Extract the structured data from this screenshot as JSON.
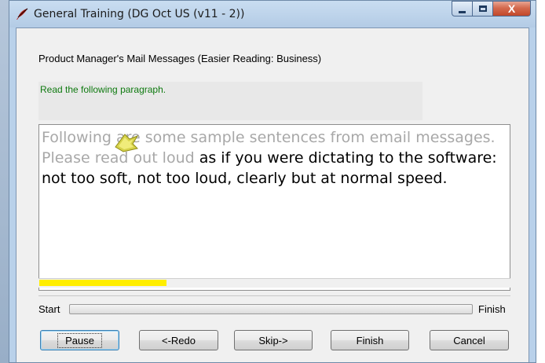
{
  "window": {
    "title": "General Training (DG Oct US (v11 - 2))",
    "controls": {
      "minimize": "minimize",
      "maximize": "maximize",
      "close": "X"
    }
  },
  "heading": "Product Manager's Mail Messages (Easier Reading: Business)",
  "instruction": "Read the following paragraph.",
  "paragraph": {
    "read_part": "Following are some sample sentences from email messages. Please read out loud",
    "unread_part": " as if you were dictating to the software: not too soft, not too loud, clearly but at normal speed."
  },
  "text_progress_fraction": 0.27,
  "progress": {
    "start_label": "Start",
    "finish_label": "Finish",
    "value_fraction": 0.0
  },
  "buttons": {
    "pause": "Pause",
    "redo": "<-Redo",
    "skip": "Skip->",
    "finish": "Finish",
    "cancel": "Cancel"
  },
  "colors": {
    "instruction_text": "#0f7a10",
    "read_text": "#a8a8a8",
    "text_progress": "#ffee00",
    "close_button": "#c1472a"
  },
  "icons": {
    "app": "quill-icon",
    "reading_marker": "reading-arrow-icon"
  }
}
